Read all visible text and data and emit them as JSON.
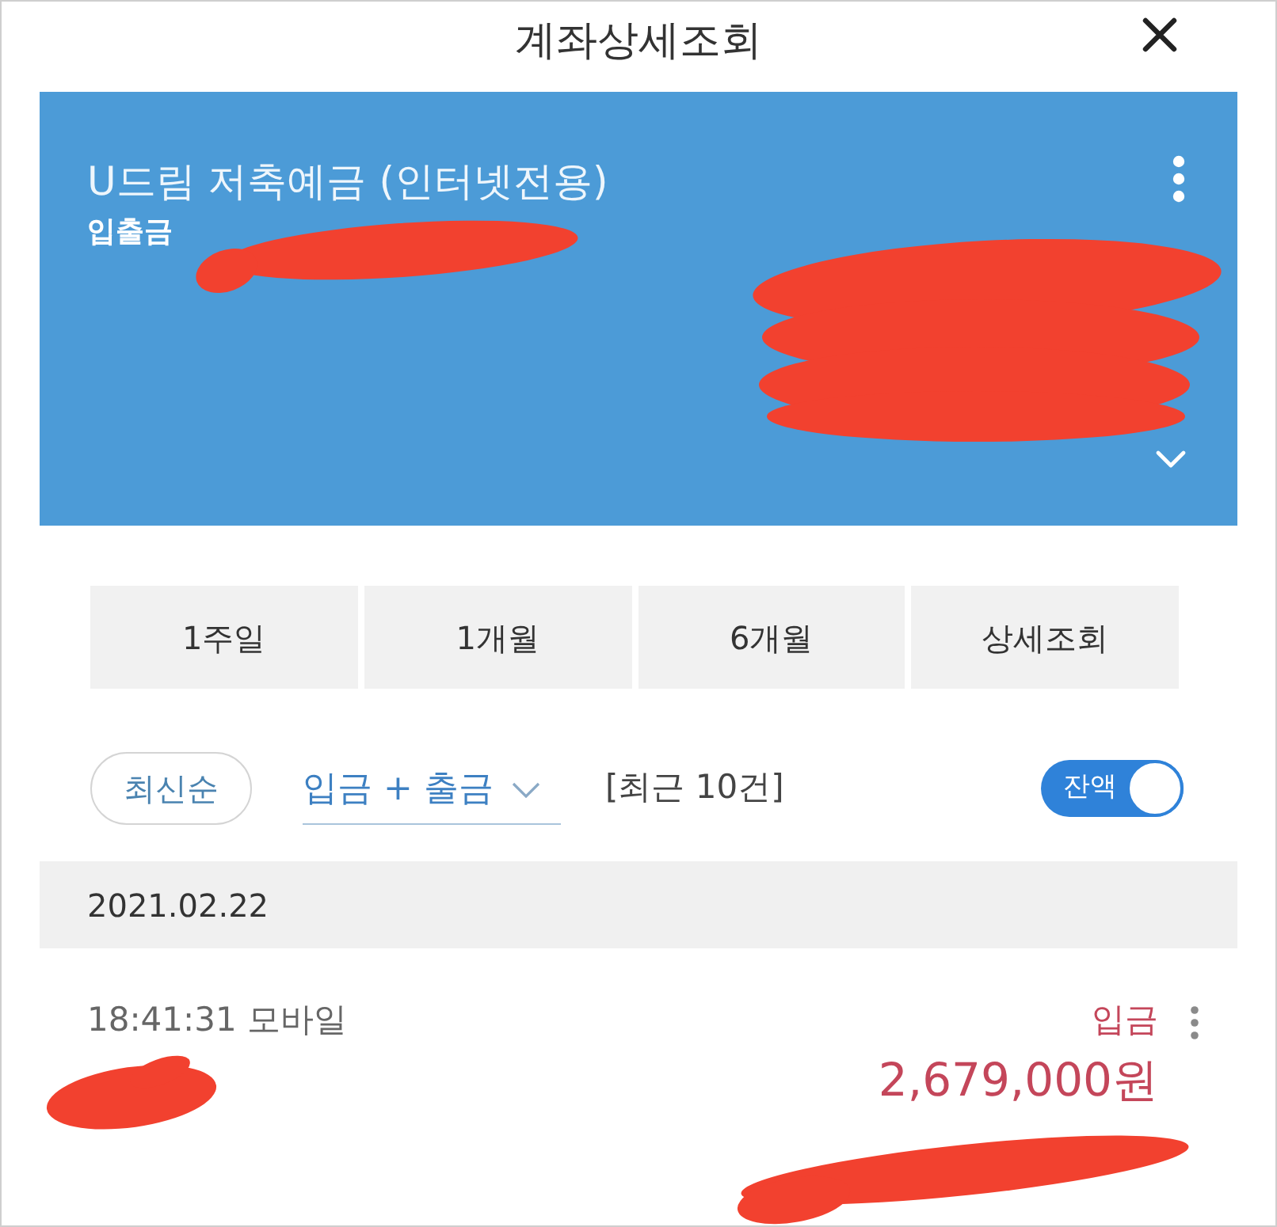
{
  "header": {
    "title": "계좌상세조회"
  },
  "account": {
    "name": "U드림 저축예금 (인터넷전용)",
    "type": "입출금"
  },
  "period_buttons": [
    {
      "label": "1주일"
    },
    {
      "label": "1개월"
    },
    {
      "label": "6개월"
    },
    {
      "label": "상세조회"
    }
  ],
  "filters": {
    "sort": "최신순",
    "direction": "입금 + 출금",
    "count": "[최근 10건]",
    "balance_toggle": {
      "label": "잔액",
      "on": true
    }
  },
  "date_groups": [
    {
      "date": "2021.02.22",
      "transactions": [
        {
          "time_channel": "18:41:31 모바일",
          "kind": "deposit",
          "type_label": "입금",
          "amount": "2,679,000원"
        }
      ]
    }
  ]
}
